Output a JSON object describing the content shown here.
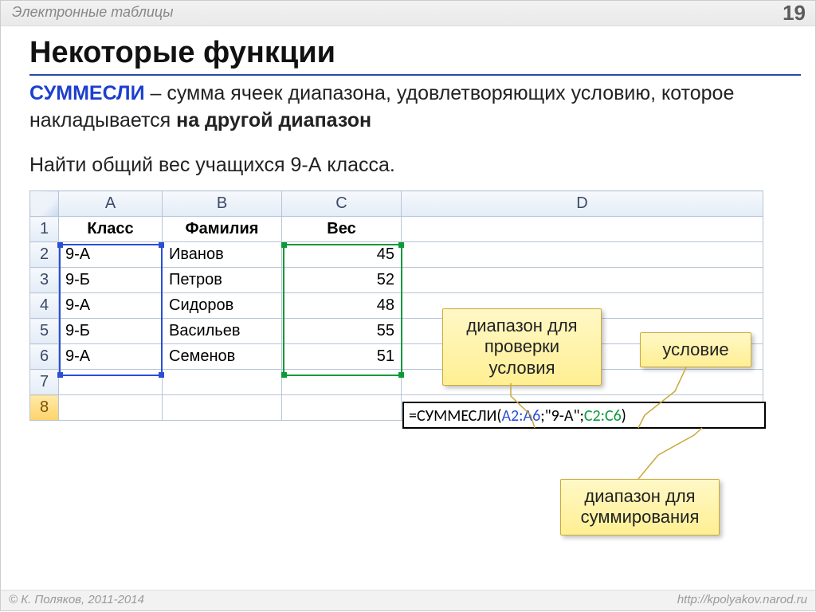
{
  "page": {
    "number": "19",
    "topic": "Электронные таблицы",
    "title": "Некоторые функции"
  },
  "description": {
    "keyword": "СУММЕСЛИ",
    "text1": " – сумма ячеек диапазона, удовлетворяющих условию, которое накладывается ",
    "emph": "на другой диапазон"
  },
  "task": "Найти общий вес учащихся 9-А класса.",
  "columns": [
    "A",
    "B",
    "C",
    "D"
  ],
  "headers": {
    "A": "Класс",
    "B": "Фамилия",
    "C": "Вес"
  },
  "rows": [
    {
      "n": "1"
    },
    {
      "n": "2",
      "A": "9-А",
      "B": "Иванов",
      "C": "45"
    },
    {
      "n": "3",
      "A": "9-Б",
      "B": "Петров",
      "C": "52"
    },
    {
      "n": "4",
      "A": "9-А",
      "B": "Сидоров",
      "C": "48"
    },
    {
      "n": "5",
      "A": "9-Б",
      "B": "Васильев",
      "C": "55"
    },
    {
      "n": "6",
      "A": "9-А",
      "B": "Семенов",
      "C": "51"
    },
    {
      "n": "7"
    },
    {
      "n": "8"
    }
  ],
  "formula": {
    "prefix": "=СУММЕСЛИ(",
    "range1": "A2:A6",
    "sep1": ";",
    "cond": "\"9-А\"",
    "sep2": ";",
    "range2": "C2:C6",
    "suffix": ")"
  },
  "callouts": {
    "range_check": "диапазон для\nпроверки\nусловия",
    "condition": "условие",
    "range_sum": "диапазон для\nсуммирования"
  },
  "footer": {
    "copyright": "© К. Поляков, 2011-2014",
    "url": "http://kpolyakov.narod.ru"
  }
}
